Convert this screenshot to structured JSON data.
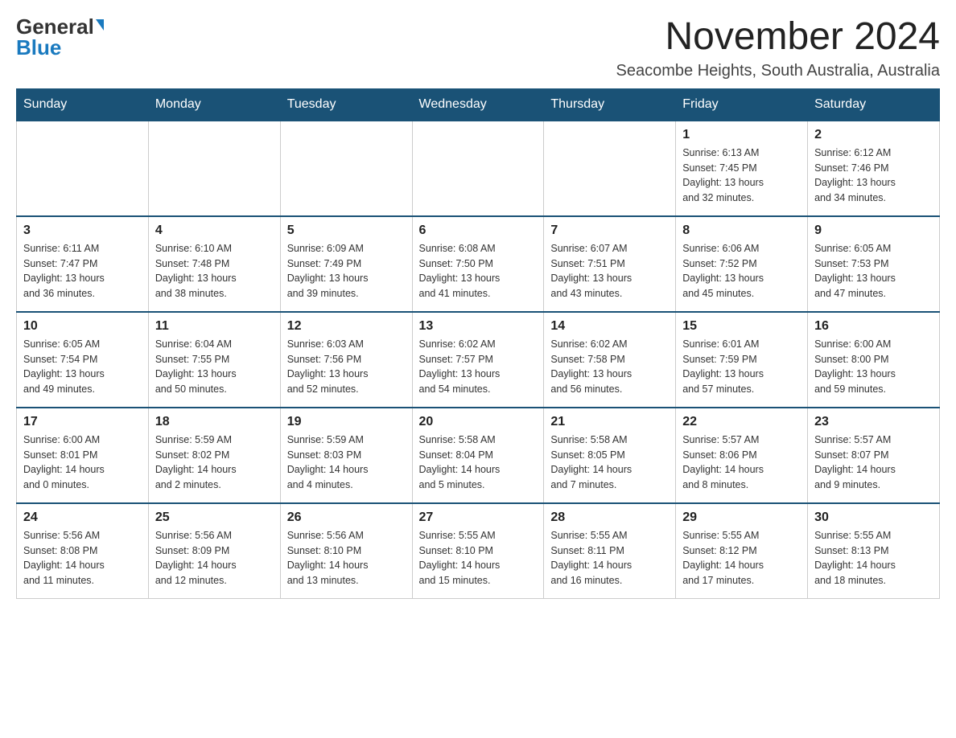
{
  "header": {
    "logo_general": "General",
    "logo_blue": "Blue",
    "month_title": "November 2024",
    "location": "Seacombe Heights, South Australia, Australia"
  },
  "weekdays": [
    "Sunday",
    "Monday",
    "Tuesday",
    "Wednesday",
    "Thursday",
    "Friday",
    "Saturday"
  ],
  "weeks": [
    {
      "days": [
        {
          "number": "",
          "info": ""
        },
        {
          "number": "",
          "info": ""
        },
        {
          "number": "",
          "info": ""
        },
        {
          "number": "",
          "info": ""
        },
        {
          "number": "",
          "info": ""
        },
        {
          "number": "1",
          "info": "Sunrise: 6:13 AM\nSunset: 7:45 PM\nDaylight: 13 hours\nand 32 minutes."
        },
        {
          "number": "2",
          "info": "Sunrise: 6:12 AM\nSunset: 7:46 PM\nDaylight: 13 hours\nand 34 minutes."
        }
      ]
    },
    {
      "days": [
        {
          "number": "3",
          "info": "Sunrise: 6:11 AM\nSunset: 7:47 PM\nDaylight: 13 hours\nand 36 minutes."
        },
        {
          "number": "4",
          "info": "Sunrise: 6:10 AM\nSunset: 7:48 PM\nDaylight: 13 hours\nand 38 minutes."
        },
        {
          "number": "5",
          "info": "Sunrise: 6:09 AM\nSunset: 7:49 PM\nDaylight: 13 hours\nand 39 minutes."
        },
        {
          "number": "6",
          "info": "Sunrise: 6:08 AM\nSunset: 7:50 PM\nDaylight: 13 hours\nand 41 minutes."
        },
        {
          "number": "7",
          "info": "Sunrise: 6:07 AM\nSunset: 7:51 PM\nDaylight: 13 hours\nand 43 minutes."
        },
        {
          "number": "8",
          "info": "Sunrise: 6:06 AM\nSunset: 7:52 PM\nDaylight: 13 hours\nand 45 minutes."
        },
        {
          "number": "9",
          "info": "Sunrise: 6:05 AM\nSunset: 7:53 PM\nDaylight: 13 hours\nand 47 minutes."
        }
      ]
    },
    {
      "days": [
        {
          "number": "10",
          "info": "Sunrise: 6:05 AM\nSunset: 7:54 PM\nDaylight: 13 hours\nand 49 minutes."
        },
        {
          "number": "11",
          "info": "Sunrise: 6:04 AM\nSunset: 7:55 PM\nDaylight: 13 hours\nand 50 minutes."
        },
        {
          "number": "12",
          "info": "Sunrise: 6:03 AM\nSunset: 7:56 PM\nDaylight: 13 hours\nand 52 minutes."
        },
        {
          "number": "13",
          "info": "Sunrise: 6:02 AM\nSunset: 7:57 PM\nDaylight: 13 hours\nand 54 minutes."
        },
        {
          "number": "14",
          "info": "Sunrise: 6:02 AM\nSunset: 7:58 PM\nDaylight: 13 hours\nand 56 minutes."
        },
        {
          "number": "15",
          "info": "Sunrise: 6:01 AM\nSunset: 7:59 PM\nDaylight: 13 hours\nand 57 minutes."
        },
        {
          "number": "16",
          "info": "Sunrise: 6:00 AM\nSunset: 8:00 PM\nDaylight: 13 hours\nand 59 minutes."
        }
      ]
    },
    {
      "days": [
        {
          "number": "17",
          "info": "Sunrise: 6:00 AM\nSunset: 8:01 PM\nDaylight: 14 hours\nand 0 minutes."
        },
        {
          "number": "18",
          "info": "Sunrise: 5:59 AM\nSunset: 8:02 PM\nDaylight: 14 hours\nand 2 minutes."
        },
        {
          "number": "19",
          "info": "Sunrise: 5:59 AM\nSunset: 8:03 PM\nDaylight: 14 hours\nand 4 minutes."
        },
        {
          "number": "20",
          "info": "Sunrise: 5:58 AM\nSunset: 8:04 PM\nDaylight: 14 hours\nand 5 minutes."
        },
        {
          "number": "21",
          "info": "Sunrise: 5:58 AM\nSunset: 8:05 PM\nDaylight: 14 hours\nand 7 minutes."
        },
        {
          "number": "22",
          "info": "Sunrise: 5:57 AM\nSunset: 8:06 PM\nDaylight: 14 hours\nand 8 minutes."
        },
        {
          "number": "23",
          "info": "Sunrise: 5:57 AM\nSunset: 8:07 PM\nDaylight: 14 hours\nand 9 minutes."
        }
      ]
    },
    {
      "days": [
        {
          "number": "24",
          "info": "Sunrise: 5:56 AM\nSunset: 8:08 PM\nDaylight: 14 hours\nand 11 minutes."
        },
        {
          "number": "25",
          "info": "Sunrise: 5:56 AM\nSunset: 8:09 PM\nDaylight: 14 hours\nand 12 minutes."
        },
        {
          "number": "26",
          "info": "Sunrise: 5:56 AM\nSunset: 8:10 PM\nDaylight: 14 hours\nand 13 minutes."
        },
        {
          "number": "27",
          "info": "Sunrise: 5:55 AM\nSunset: 8:10 PM\nDaylight: 14 hours\nand 15 minutes."
        },
        {
          "number": "28",
          "info": "Sunrise: 5:55 AM\nSunset: 8:11 PM\nDaylight: 14 hours\nand 16 minutes."
        },
        {
          "number": "29",
          "info": "Sunrise: 5:55 AM\nSunset: 8:12 PM\nDaylight: 14 hours\nand 17 minutes."
        },
        {
          "number": "30",
          "info": "Sunrise: 5:55 AM\nSunset: 8:13 PM\nDaylight: 14 hours\nand 18 minutes."
        }
      ]
    }
  ]
}
